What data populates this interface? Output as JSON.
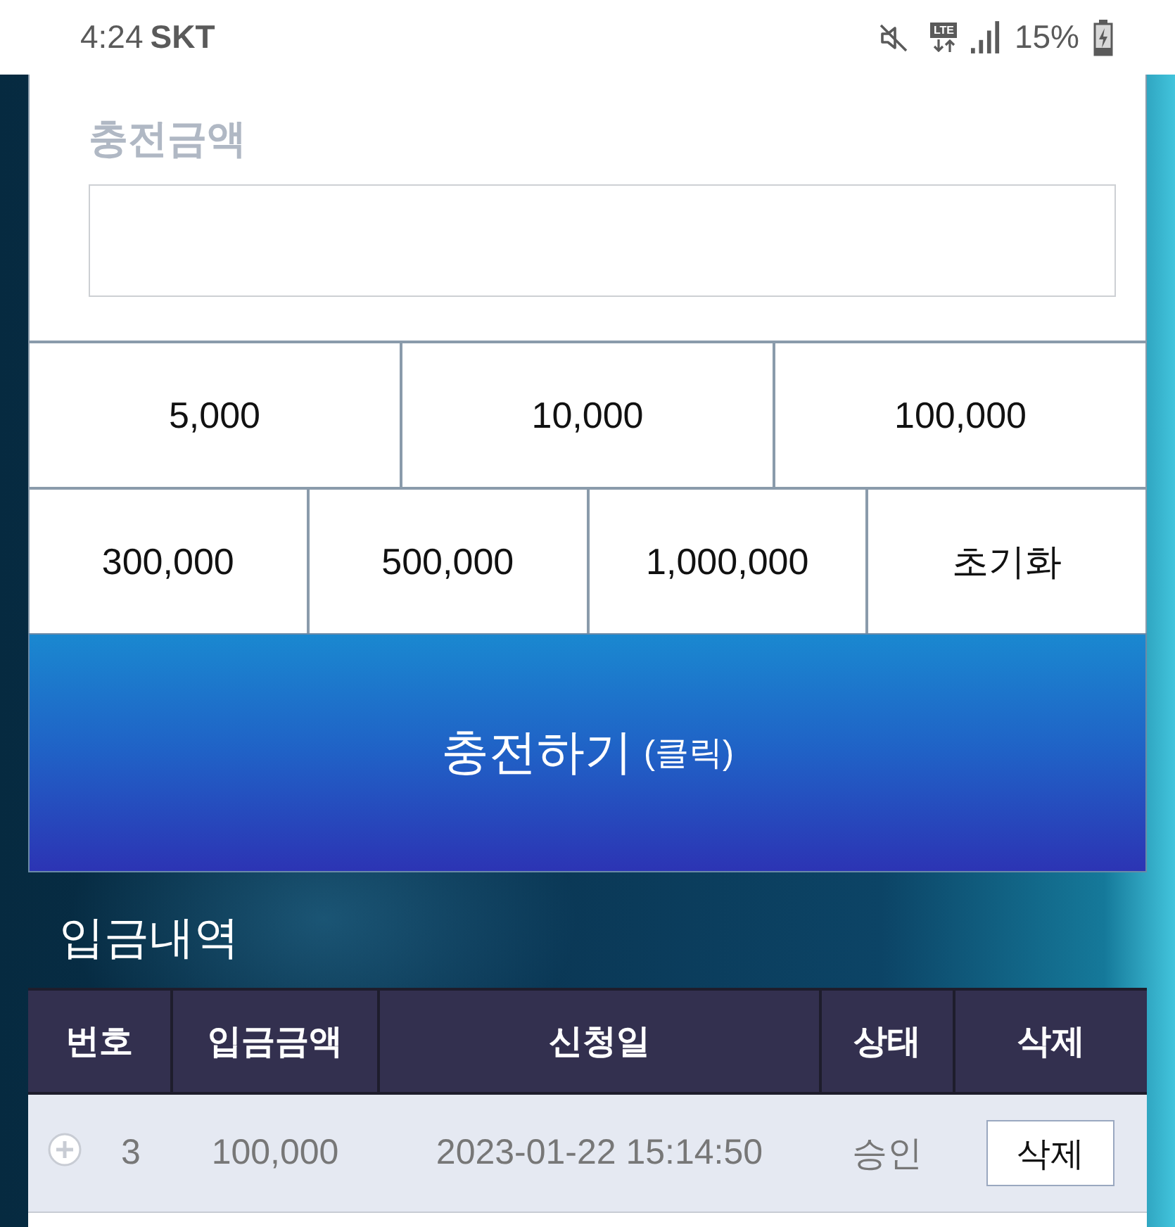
{
  "status_bar": {
    "time": "4:24",
    "carrier": "SKT",
    "network": "LTE",
    "battery": "15%"
  },
  "charge_form": {
    "label": "충전금액",
    "amount_rows": [
      [
        "5,000",
        "10,000",
        "100,000"
      ],
      [
        "300,000",
        "500,000",
        "1,000,000",
        "초기화"
      ]
    ],
    "submit_button": {
      "label": "충전하기",
      "hint": "(클릭)"
    }
  },
  "history": {
    "title": "입금내역",
    "columns": [
      "번호",
      "입금금액",
      "신청일",
      "상태",
      "삭제"
    ],
    "rows": [
      {
        "expanded": false,
        "number": "3",
        "amount": "100,000",
        "date": "2023-01-22 15:14:50",
        "status": "승인",
        "delete_label": "삭제"
      }
    ]
  }
}
